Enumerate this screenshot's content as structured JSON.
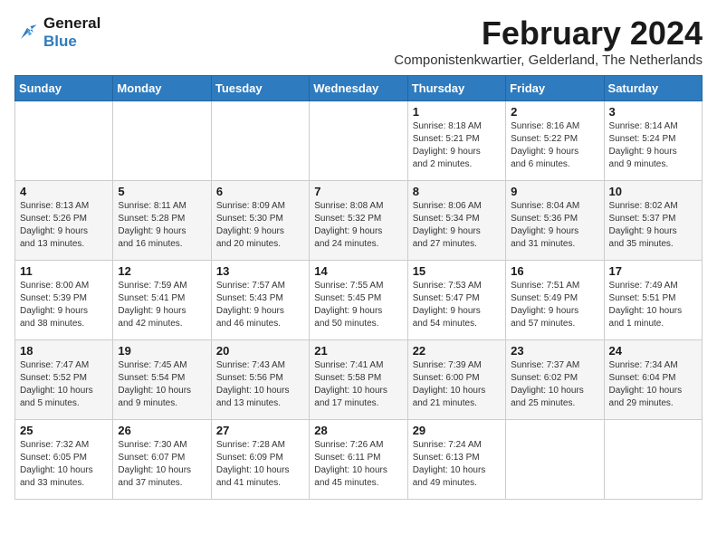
{
  "logo": {
    "line1": "General",
    "line2": "Blue"
  },
  "title": "February 2024",
  "subtitle": "Componistenkwartier, Gelderland, The Netherlands",
  "weekdays": [
    "Sunday",
    "Monday",
    "Tuesday",
    "Wednesday",
    "Thursday",
    "Friday",
    "Saturday"
  ],
  "weeks": [
    [
      {
        "day": "",
        "info": ""
      },
      {
        "day": "",
        "info": ""
      },
      {
        "day": "",
        "info": ""
      },
      {
        "day": "",
        "info": ""
      },
      {
        "day": "1",
        "info": "Sunrise: 8:18 AM\nSunset: 5:21 PM\nDaylight: 9 hours\nand 2 minutes."
      },
      {
        "day": "2",
        "info": "Sunrise: 8:16 AM\nSunset: 5:22 PM\nDaylight: 9 hours\nand 6 minutes."
      },
      {
        "day": "3",
        "info": "Sunrise: 8:14 AM\nSunset: 5:24 PM\nDaylight: 9 hours\nand 9 minutes."
      }
    ],
    [
      {
        "day": "4",
        "info": "Sunrise: 8:13 AM\nSunset: 5:26 PM\nDaylight: 9 hours\nand 13 minutes."
      },
      {
        "day": "5",
        "info": "Sunrise: 8:11 AM\nSunset: 5:28 PM\nDaylight: 9 hours\nand 16 minutes."
      },
      {
        "day": "6",
        "info": "Sunrise: 8:09 AM\nSunset: 5:30 PM\nDaylight: 9 hours\nand 20 minutes."
      },
      {
        "day": "7",
        "info": "Sunrise: 8:08 AM\nSunset: 5:32 PM\nDaylight: 9 hours\nand 24 minutes."
      },
      {
        "day": "8",
        "info": "Sunrise: 8:06 AM\nSunset: 5:34 PM\nDaylight: 9 hours\nand 27 minutes."
      },
      {
        "day": "9",
        "info": "Sunrise: 8:04 AM\nSunset: 5:36 PM\nDaylight: 9 hours\nand 31 minutes."
      },
      {
        "day": "10",
        "info": "Sunrise: 8:02 AM\nSunset: 5:37 PM\nDaylight: 9 hours\nand 35 minutes."
      }
    ],
    [
      {
        "day": "11",
        "info": "Sunrise: 8:00 AM\nSunset: 5:39 PM\nDaylight: 9 hours\nand 38 minutes."
      },
      {
        "day": "12",
        "info": "Sunrise: 7:59 AM\nSunset: 5:41 PM\nDaylight: 9 hours\nand 42 minutes."
      },
      {
        "day": "13",
        "info": "Sunrise: 7:57 AM\nSunset: 5:43 PM\nDaylight: 9 hours\nand 46 minutes."
      },
      {
        "day": "14",
        "info": "Sunrise: 7:55 AM\nSunset: 5:45 PM\nDaylight: 9 hours\nand 50 minutes."
      },
      {
        "day": "15",
        "info": "Sunrise: 7:53 AM\nSunset: 5:47 PM\nDaylight: 9 hours\nand 54 minutes."
      },
      {
        "day": "16",
        "info": "Sunrise: 7:51 AM\nSunset: 5:49 PM\nDaylight: 9 hours\nand 57 minutes."
      },
      {
        "day": "17",
        "info": "Sunrise: 7:49 AM\nSunset: 5:51 PM\nDaylight: 10 hours\nand 1 minute."
      }
    ],
    [
      {
        "day": "18",
        "info": "Sunrise: 7:47 AM\nSunset: 5:52 PM\nDaylight: 10 hours\nand 5 minutes."
      },
      {
        "day": "19",
        "info": "Sunrise: 7:45 AM\nSunset: 5:54 PM\nDaylight: 10 hours\nand 9 minutes."
      },
      {
        "day": "20",
        "info": "Sunrise: 7:43 AM\nSunset: 5:56 PM\nDaylight: 10 hours\nand 13 minutes."
      },
      {
        "day": "21",
        "info": "Sunrise: 7:41 AM\nSunset: 5:58 PM\nDaylight: 10 hours\nand 17 minutes."
      },
      {
        "day": "22",
        "info": "Sunrise: 7:39 AM\nSunset: 6:00 PM\nDaylight: 10 hours\nand 21 minutes."
      },
      {
        "day": "23",
        "info": "Sunrise: 7:37 AM\nSunset: 6:02 PM\nDaylight: 10 hours\nand 25 minutes."
      },
      {
        "day": "24",
        "info": "Sunrise: 7:34 AM\nSunset: 6:04 PM\nDaylight: 10 hours\nand 29 minutes."
      }
    ],
    [
      {
        "day": "25",
        "info": "Sunrise: 7:32 AM\nSunset: 6:05 PM\nDaylight: 10 hours\nand 33 minutes."
      },
      {
        "day": "26",
        "info": "Sunrise: 7:30 AM\nSunset: 6:07 PM\nDaylight: 10 hours\nand 37 minutes."
      },
      {
        "day": "27",
        "info": "Sunrise: 7:28 AM\nSunset: 6:09 PM\nDaylight: 10 hours\nand 41 minutes."
      },
      {
        "day": "28",
        "info": "Sunrise: 7:26 AM\nSunset: 6:11 PM\nDaylight: 10 hours\nand 45 minutes."
      },
      {
        "day": "29",
        "info": "Sunrise: 7:24 AM\nSunset: 6:13 PM\nDaylight: 10 hours\nand 49 minutes."
      },
      {
        "day": "",
        "info": ""
      },
      {
        "day": "",
        "info": ""
      }
    ]
  ]
}
